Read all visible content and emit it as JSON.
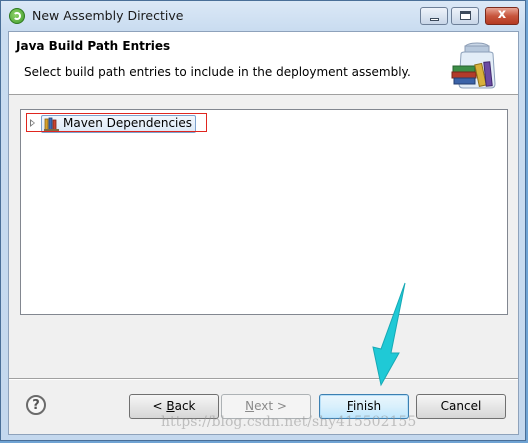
{
  "window": {
    "title": "New Assembly Directive",
    "close_glyph": "x"
  },
  "header": {
    "title": "Java Build Path Entries",
    "description": "Select build path entries to include in the deployment assembly.",
    "icon": "jar-library-icon"
  },
  "tree": {
    "items": [
      {
        "label": "Maven Dependencies",
        "icon": "library-icon",
        "expanded": false,
        "highlighted": true
      }
    ]
  },
  "footer": {
    "help_glyph": "?",
    "back": {
      "prefix": "< ",
      "mnemonic": "B",
      "rest": "ack"
    },
    "next": {
      "mnemonic": "N",
      "rest": "ext >"
    },
    "finish": {
      "mnemonic": "F",
      "rest": "inish"
    },
    "cancel": {
      "label": "Cancel"
    }
  },
  "watermark": "https://blog.csdn.net/shy415502155",
  "colors": {
    "highlight_box": "#e0261f",
    "arrow": "#1fc9d6",
    "finish_border": "#3c7fb1"
  }
}
